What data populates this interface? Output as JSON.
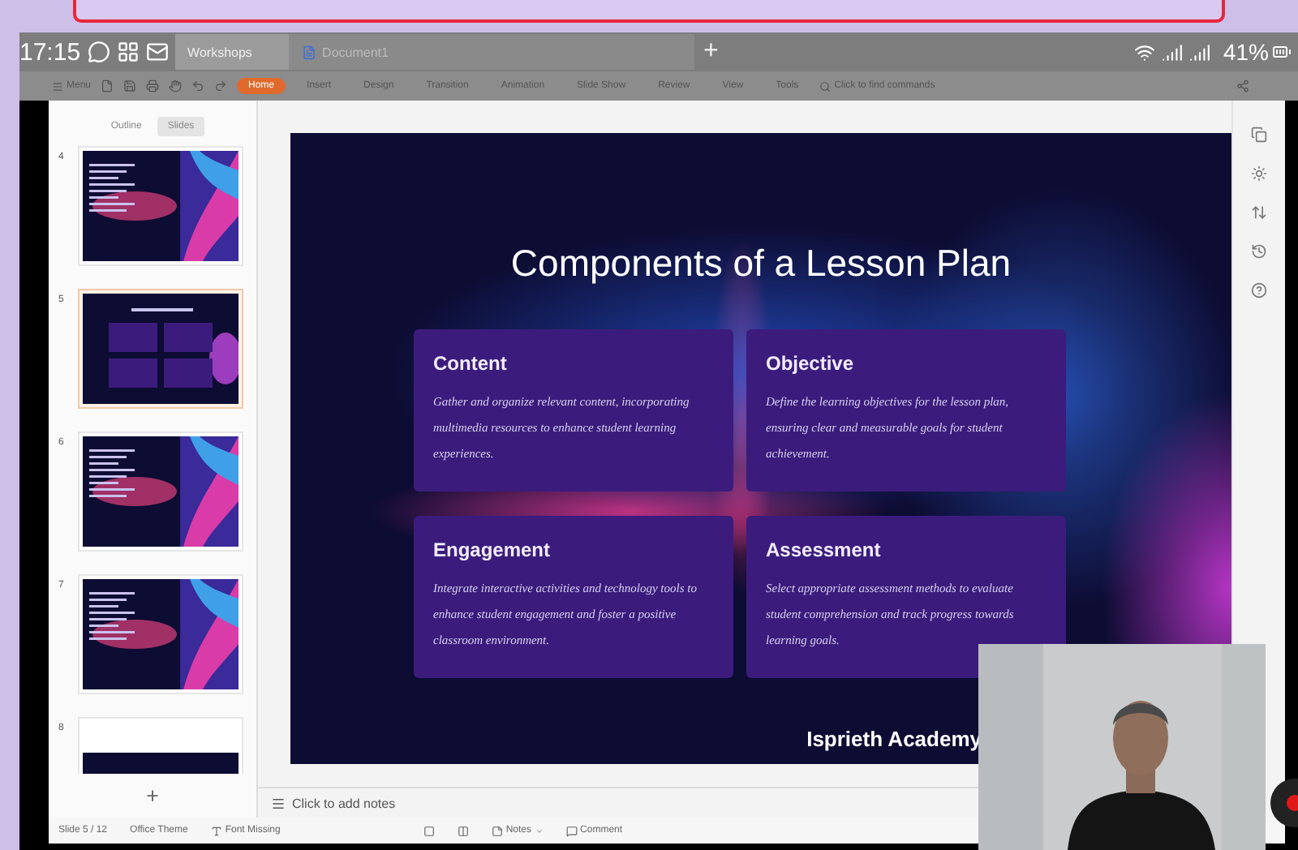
{
  "status_bar": {
    "time": "17:15",
    "battery": "41%"
  },
  "browser_tabs": [
    {
      "label": "Workshops",
      "selected": true
    },
    {
      "label": "Document1",
      "selected": false
    }
  ],
  "new_tab": "+",
  "toolbar": {
    "menu": "Menu",
    "tabs": [
      {
        "label": "Home",
        "selected": true
      },
      {
        "label": "Insert",
        "selected": false
      },
      {
        "label": "Design",
        "selected": false
      },
      {
        "label": "Transition",
        "selected": false
      },
      {
        "label": "Animation",
        "selected": false
      },
      {
        "label": "Slide Show",
        "selected": false
      },
      {
        "label": "Review",
        "selected": false
      },
      {
        "label": "View",
        "selected": false
      },
      {
        "label": "Tools",
        "selected": false
      }
    ],
    "search": {
      "placeholder": "Click to find commands"
    }
  },
  "panel_tabs": [
    {
      "label": "Outline",
      "selected": false
    },
    {
      "label": "Slides",
      "selected": true
    }
  ],
  "thumbnails": [
    {
      "number": "4",
      "selected": false,
      "kind": "split"
    },
    {
      "number": "5",
      "selected": true,
      "kind": "grid"
    },
    {
      "number": "6",
      "selected": false,
      "kind": "split"
    },
    {
      "number": "7",
      "selected": false,
      "kind": "split"
    },
    {
      "number": "8",
      "selected": false,
      "kind": "partial"
    }
  ],
  "add_slide": "+",
  "slide": {
    "title": "Components of a Lesson Plan",
    "cards": [
      {
        "heading": "Content",
        "body": "Gather and organize relevant content, incorporating multimedia resources to enhance student learning experiences."
      },
      {
        "heading": "Objective",
        "body": "Define the learning objectives for the lesson plan, ensuring clear and measurable goals for student achievement."
      },
      {
        "heading": "Engagement",
        "body": "Integrate interactive activities and technology tools to enhance student engagement and foster a positive classroom environment."
      },
      {
        "heading": "Assessment",
        "body": "Select appropriate assessment methods to evaluate student comprehension and track progress towards learning goals."
      }
    ],
    "footer": "Isprieth Academy"
  },
  "notes": {
    "placeholder": "Click to add notes"
  },
  "footer": {
    "slide_count": "Slide 5 / 12",
    "theme": "Office Theme",
    "font_warning": "Font Missing",
    "notes": "Notes",
    "comment": "Comment"
  }
}
